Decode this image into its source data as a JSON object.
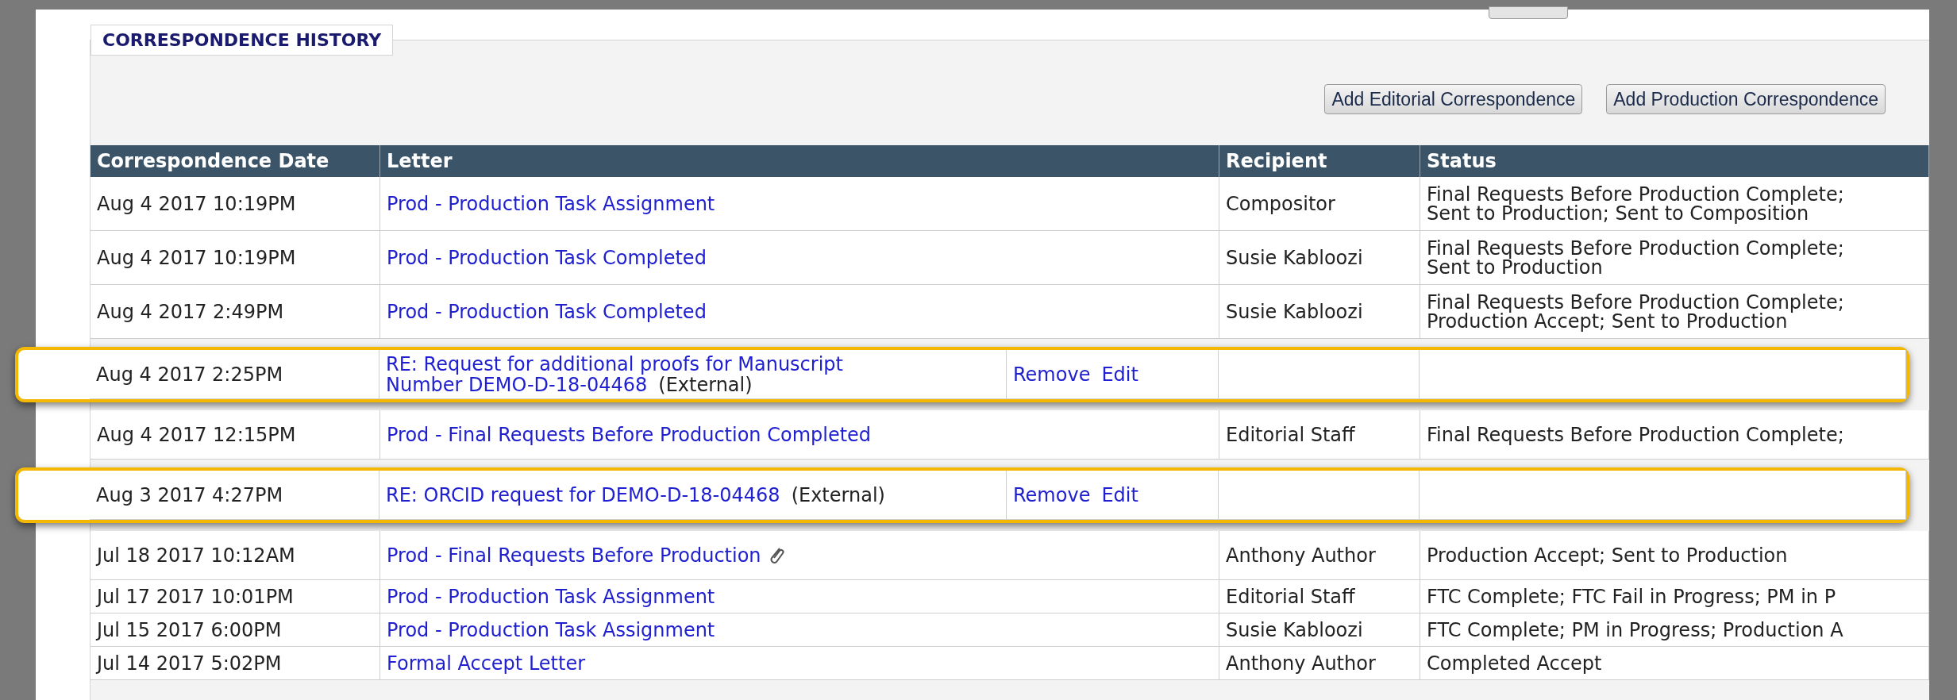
{
  "section_title": "CORRESPONDENCE HISTORY",
  "buttons": [
    "Add Editorial Correspondence",
    "Add Production Correspondence"
  ],
  "table": {
    "columns": [
      "Correspondence Date",
      "Letter",
      "Recipient",
      "Status"
    ],
    "rows": [
      {
        "kind": "letter",
        "highlighted": false,
        "date": "Aug 4 2017 10:19PM",
        "letter": "Prod - Production Task Assignment",
        "recipient": "Compositor",
        "status": [
          "Final Requests Before Production Complete;",
          "Sent to Production; Sent to Composition"
        ]
      },
      {
        "kind": "letter",
        "highlighted": false,
        "date": "Aug 4 2017 10:19PM",
        "letter": "Prod - Production Task Completed",
        "recipient": "Susie Kabloozi",
        "status": [
          "Final Requests Before Production Complete;",
          "Sent to Production"
        ]
      },
      {
        "kind": "letter",
        "highlighted": false,
        "date": "Aug 4 2017 2:49PM",
        "letter": "Prod - Production Task Completed",
        "recipient": "Susie Kabloozi",
        "status": [
          "Final Requests Before Production Complete;",
          "Production Accept; Sent to Production"
        ]
      },
      {
        "kind": "external",
        "highlighted": true,
        "date": "Aug 4 2017 2:25PM",
        "letter": [
          "RE: Request for additional proofs for Manuscript",
          "Number DEMO-D-18-04468"
        ],
        "note": "(External)",
        "actions": [
          "Remove",
          "Edit"
        ]
      },
      {
        "kind": "letter",
        "highlighted": false,
        "date": "Aug 4 2017 12:15PM",
        "letter": "Prod - Final Requests Before Production Completed",
        "recipient": "Editorial Staff",
        "status": [
          "Final Requests Before Production Complete;"
        ]
      },
      {
        "kind": "external",
        "highlighted": true,
        "date": "Aug 3 2017 4:27PM",
        "letter": [
          "RE: ORCID request for DEMO-D-18-04468"
        ],
        "note": "(External)",
        "actions": [
          "Remove",
          "Edit"
        ]
      },
      {
        "kind": "letter",
        "highlighted": false,
        "date": "Jul 18 2017 10:12AM",
        "letter": "Prod - Final Requests Before Production",
        "attachment": true,
        "recipient": "Anthony Author",
        "status": [
          "Production Accept; Sent to Production"
        ]
      },
      {
        "kind": "letter",
        "highlighted": false,
        "date": "Jul 17 2017 10:01PM",
        "letter": "Prod - Production Task Assignment",
        "recipient": "Editorial Staff",
        "status": [
          "FTC Complete; FTC Fail in Progress; PM in P"
        ]
      },
      {
        "kind": "letter",
        "highlighted": false,
        "date": "Jul 15 2017 6:00PM",
        "letter": "Prod - Production Task Assignment",
        "recipient": "Susie Kabloozi",
        "status": [
          "FTC Complete; PM in Progress; Production A"
        ]
      },
      {
        "kind": "letter",
        "highlighted": false,
        "date": "Jul 14 2017 5:02PM",
        "letter": "Formal Accept Letter",
        "recipient": "Anthony Author",
        "status": [
          "Completed Accept"
        ]
      }
    ]
  }
}
